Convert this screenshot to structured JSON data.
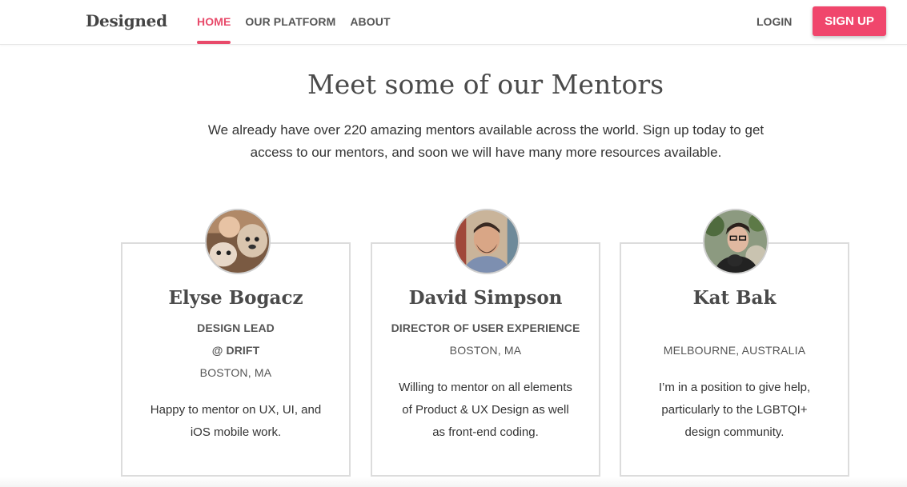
{
  "header": {
    "brand": "Designed",
    "nav": [
      {
        "label": "HOME",
        "active": true
      },
      {
        "label": "OUR PLATFORM",
        "active": false
      },
      {
        "label": "ABOUT",
        "active": false
      }
    ],
    "login_label": "LOGIN",
    "signup_label": "SIGN UP"
  },
  "hero": {
    "title": "Meet some of our Mentors",
    "intro": "We already have over 220 amazing mentors available across the world. Sign up today to get access to our mentors, and soon we will have many more resources available."
  },
  "mentors": [
    {
      "name": "Elyse Bogacz",
      "title": "DESIGN LEAD",
      "company": "@ DRIFT",
      "location": "BOSTON, MA",
      "bio": "Happy to mentor on UX, UI, and iOS mobile work."
    },
    {
      "name": "David Simpson",
      "title": "DIRECTOR OF USER EXPERIENCE",
      "location": "BOSTON, MA",
      "bio": "Willing to mentor on all elements of Product & UX Design as well as front-end coding."
    },
    {
      "name": "Kat Bak",
      "location": "MELBOURNE, AUSTRALIA",
      "bio": "I’m in a position to give help, particularly to the LGBTQI+ design community."
    }
  ],
  "colors": {
    "accent": "#f0466c",
    "active_nav": "#e84a6a",
    "card_border": "#dcdcdc"
  }
}
